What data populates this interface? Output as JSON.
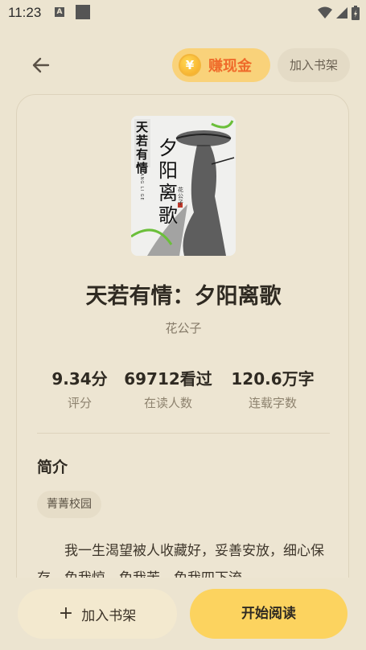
{
  "status_bar": {
    "time": "11:23",
    "notification_letter": "A"
  },
  "header": {
    "earn_label": "赚现金",
    "coin_symbol": "¥",
    "add_shelf_label": "加入书架"
  },
  "book": {
    "title": "天若有情：夕阳离歌",
    "author": "花公子",
    "cover_series_text": "天若有情",
    "cover_title_text": "夕阳离歌",
    "cover_pinyin": "XI YANG LI GE",
    "cover_author_text": "花公子"
  },
  "stats": [
    {
      "value": "9.34分",
      "label": "评分"
    },
    {
      "value": "69712看过",
      "label": "在读人数"
    },
    {
      "value": "120.6万字",
      "label": "连载字数"
    }
  ],
  "intro": {
    "heading": "简介",
    "tag": "菁菁校园",
    "text": "我一生渴望被人收藏好，妥善安放，细心保存。免我惊，免我苦，免我四下流"
  },
  "bottom": {
    "add_shelf": "加入书架",
    "plus": "+",
    "start_reading": "开始阅读"
  },
  "colors": {
    "background": "#ece4d0",
    "accent_yellow": "#fcd35f",
    "earn_orange": "#ef6a2a"
  }
}
